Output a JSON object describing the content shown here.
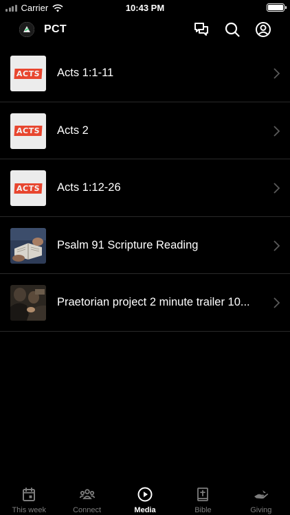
{
  "status_bar": {
    "carrier": "Carrier",
    "time": "10:43 PM"
  },
  "header": {
    "title": "PCT",
    "icons": [
      "chat-icon",
      "search-icon",
      "account-icon"
    ]
  },
  "media": {
    "items": [
      {
        "title": "Acts 1:1-11",
        "thumb_text": "ACTS",
        "thumb_type": "acts"
      },
      {
        "title": "Acts 2",
        "thumb_text": "ACTS",
        "thumb_type": "acts"
      },
      {
        "title": "Acts 1:12-26",
        "thumb_text": "ACTS",
        "thumb_type": "acts"
      },
      {
        "title": "Psalm 91 Scripture Reading",
        "thumb_type": "bible-photo"
      },
      {
        "title": "Praetorian project 2 minute trailer 10...",
        "thumb_type": "people-photo"
      }
    ]
  },
  "tabs": [
    {
      "label": "This week",
      "icon": "calendar-icon",
      "active": false
    },
    {
      "label": "Connect",
      "icon": "people-icon",
      "active": false
    },
    {
      "label": "Media",
      "icon": "play-circle-icon",
      "active": true
    },
    {
      "label": "Bible",
      "icon": "bible-icon",
      "active": false
    },
    {
      "label": "Giving",
      "icon": "giving-hand-icon",
      "active": false
    }
  ],
  "colors": {
    "background": "#000000",
    "separator": "#2a2a2a",
    "tab_inactive": "#7d7d7d",
    "acts_red": "#e8462f"
  }
}
